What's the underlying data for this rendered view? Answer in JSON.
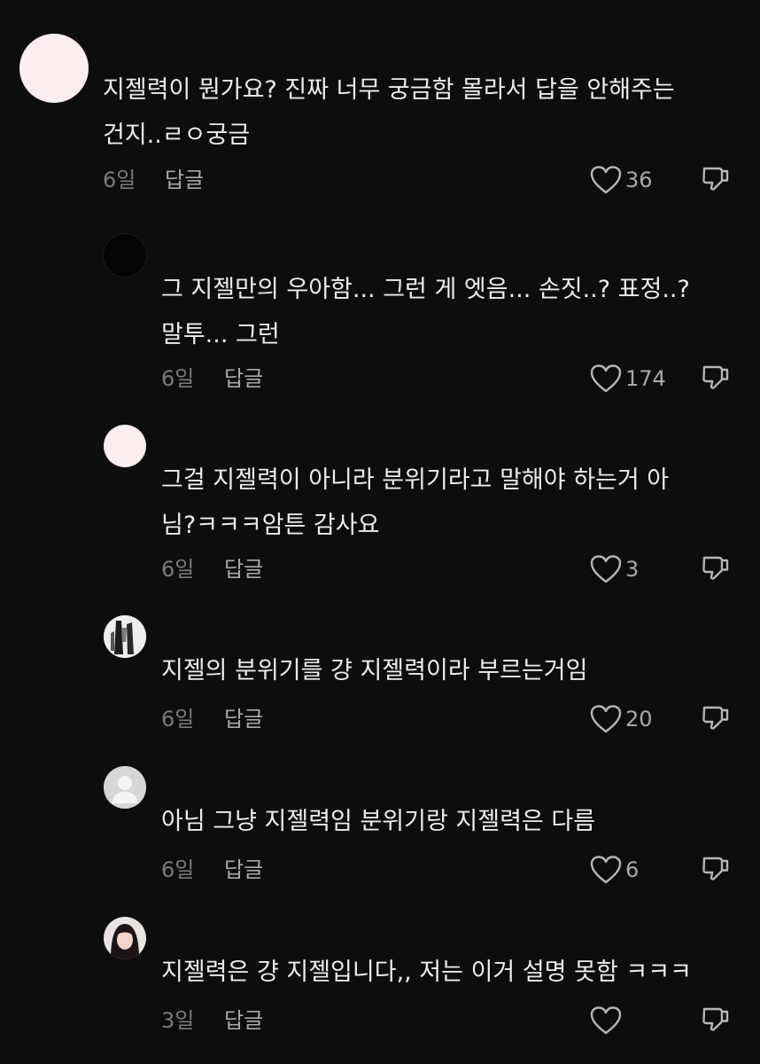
{
  "reply_label": "답글",
  "comments": [
    {
      "text": "지젤력이 뭔가요? 진짜 너무 궁금함 몰라서 답을 안해주는\n건지..ㄹㅇ궁금",
      "age": "6일",
      "likes": "36",
      "avatar_color": "#fbeeee",
      "avatar": "plain"
    },
    {
      "text": "그 지젤만의 우아함... 그런 게 엣음... 손짓..? 표정..?\n말투... 그런",
      "age": "6일",
      "likes": "174",
      "avatar_color": "#050505",
      "avatar": "plain"
    },
    {
      "text": "그걸 지젤력이 아니라 분위기라고 말해야 하는거 아\n님?ㅋㅋㅋ암튼 감사요",
      "age": "6일",
      "likes": "3",
      "avatar_color": "#fbeeee",
      "avatar": "plain"
    },
    {
      "text": "지젤의 분위기를 걍 지젤력이라 부르는거임",
      "age": "6일",
      "likes": "20",
      "avatar_color": "#e8e8e8",
      "avatar": "photo-bw"
    },
    {
      "text": "아님 그냥 지젤력임 분위기랑 지젤력은 다름",
      "age": "6일",
      "likes": "6",
      "avatar_color": "#d6d6d6",
      "avatar": "default-person"
    },
    {
      "text": "지젤력은 걍 지젤입니다,, 저는 이거 설명 못함 ㅋㅋㅋ",
      "age": "3일",
      "likes": "",
      "avatar_color": "#3a3030",
      "avatar": "photo-girl"
    }
  ]
}
